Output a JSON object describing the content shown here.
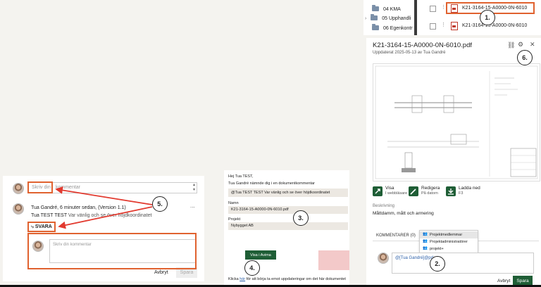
{
  "steps": [
    "1.",
    "2.",
    "3.",
    "4.",
    "5.",
    "6."
  ],
  "file_list": {
    "folders": [
      {
        "name": "04 KMA"
      },
      {
        "name": "05 Upphandli",
        "has_chevron": true
      },
      {
        "name": "06 Egenkontr"
      }
    ],
    "files": [
      {
        "name": "K21-3164-15-A0000-0N-6010",
        "highlighted": true
      },
      {
        "name": "K21-3164-15-A0000-0N-6010",
        "highlighted": false
      }
    ]
  },
  "preview": {
    "title": "K21-3164-15-A0000-0N-6010.pdf",
    "updated_label": "Uppdaterat",
    "updated_value": "2025-05-13 av Tua Gandré",
    "actions": [
      {
        "label": "Visa",
        "sub": "I webbläsare"
      },
      {
        "label": "Redigera",
        "sub": "På datorn"
      },
      {
        "label": "Ladda ned",
        "sub": "F3"
      }
    ],
    "description_label": "Beskrivning",
    "description_value": "Måttdamm, mått och armering",
    "comments_tab": "KOMMENTARER (0)",
    "mention_options": [
      "Projektmedlemmar",
      "Projektadministratörer",
      "projekt+"
    ],
    "comment_input_value": "@[Tua Gandré]@pd",
    "cancel_label": "Avbryt",
    "send_label": "Spara"
  },
  "email": {
    "greeting": "Hej Tua TEST,",
    "intro": "Tua Gandré nämnde dig i en dokumentkommentar",
    "quote": "@Tua TEST TEST Var vänlig och se över höjdkoordinatet",
    "name_label": "Namn",
    "name_value": "K21-3164-15-A0000-0N-6010.pdf",
    "project_label": "Projekt",
    "project_value": "Nybygget AB",
    "button_label": "Visa i Avima",
    "footer_prefix": "Klicka",
    "footer_link": "här",
    "footer_suffix": "för att börja ta emot uppdateringar om det här dokumentet"
  },
  "comment_panel": {
    "new_comment_placeholder_a": "Skriv din",
    "new_comment_placeholder_b": "kommentar",
    "author_line": "Tua Gandré, 6 minuter sedan, (Version 1.1)",
    "mention_name": "Tua TEST TEST",
    "mention_text": "Var vänlig och se över höjdkoordinatet",
    "more_label": "...",
    "reply_label": "SVARA",
    "reply_placeholder": "Skriv din kommentar",
    "cancel_label": "Avbryt",
    "save_label": "Spara"
  },
  "colors": {
    "accent_orange": "#e0622f",
    "brand_green": "#1f5e36",
    "mention_blue": "#2b5fa8"
  }
}
